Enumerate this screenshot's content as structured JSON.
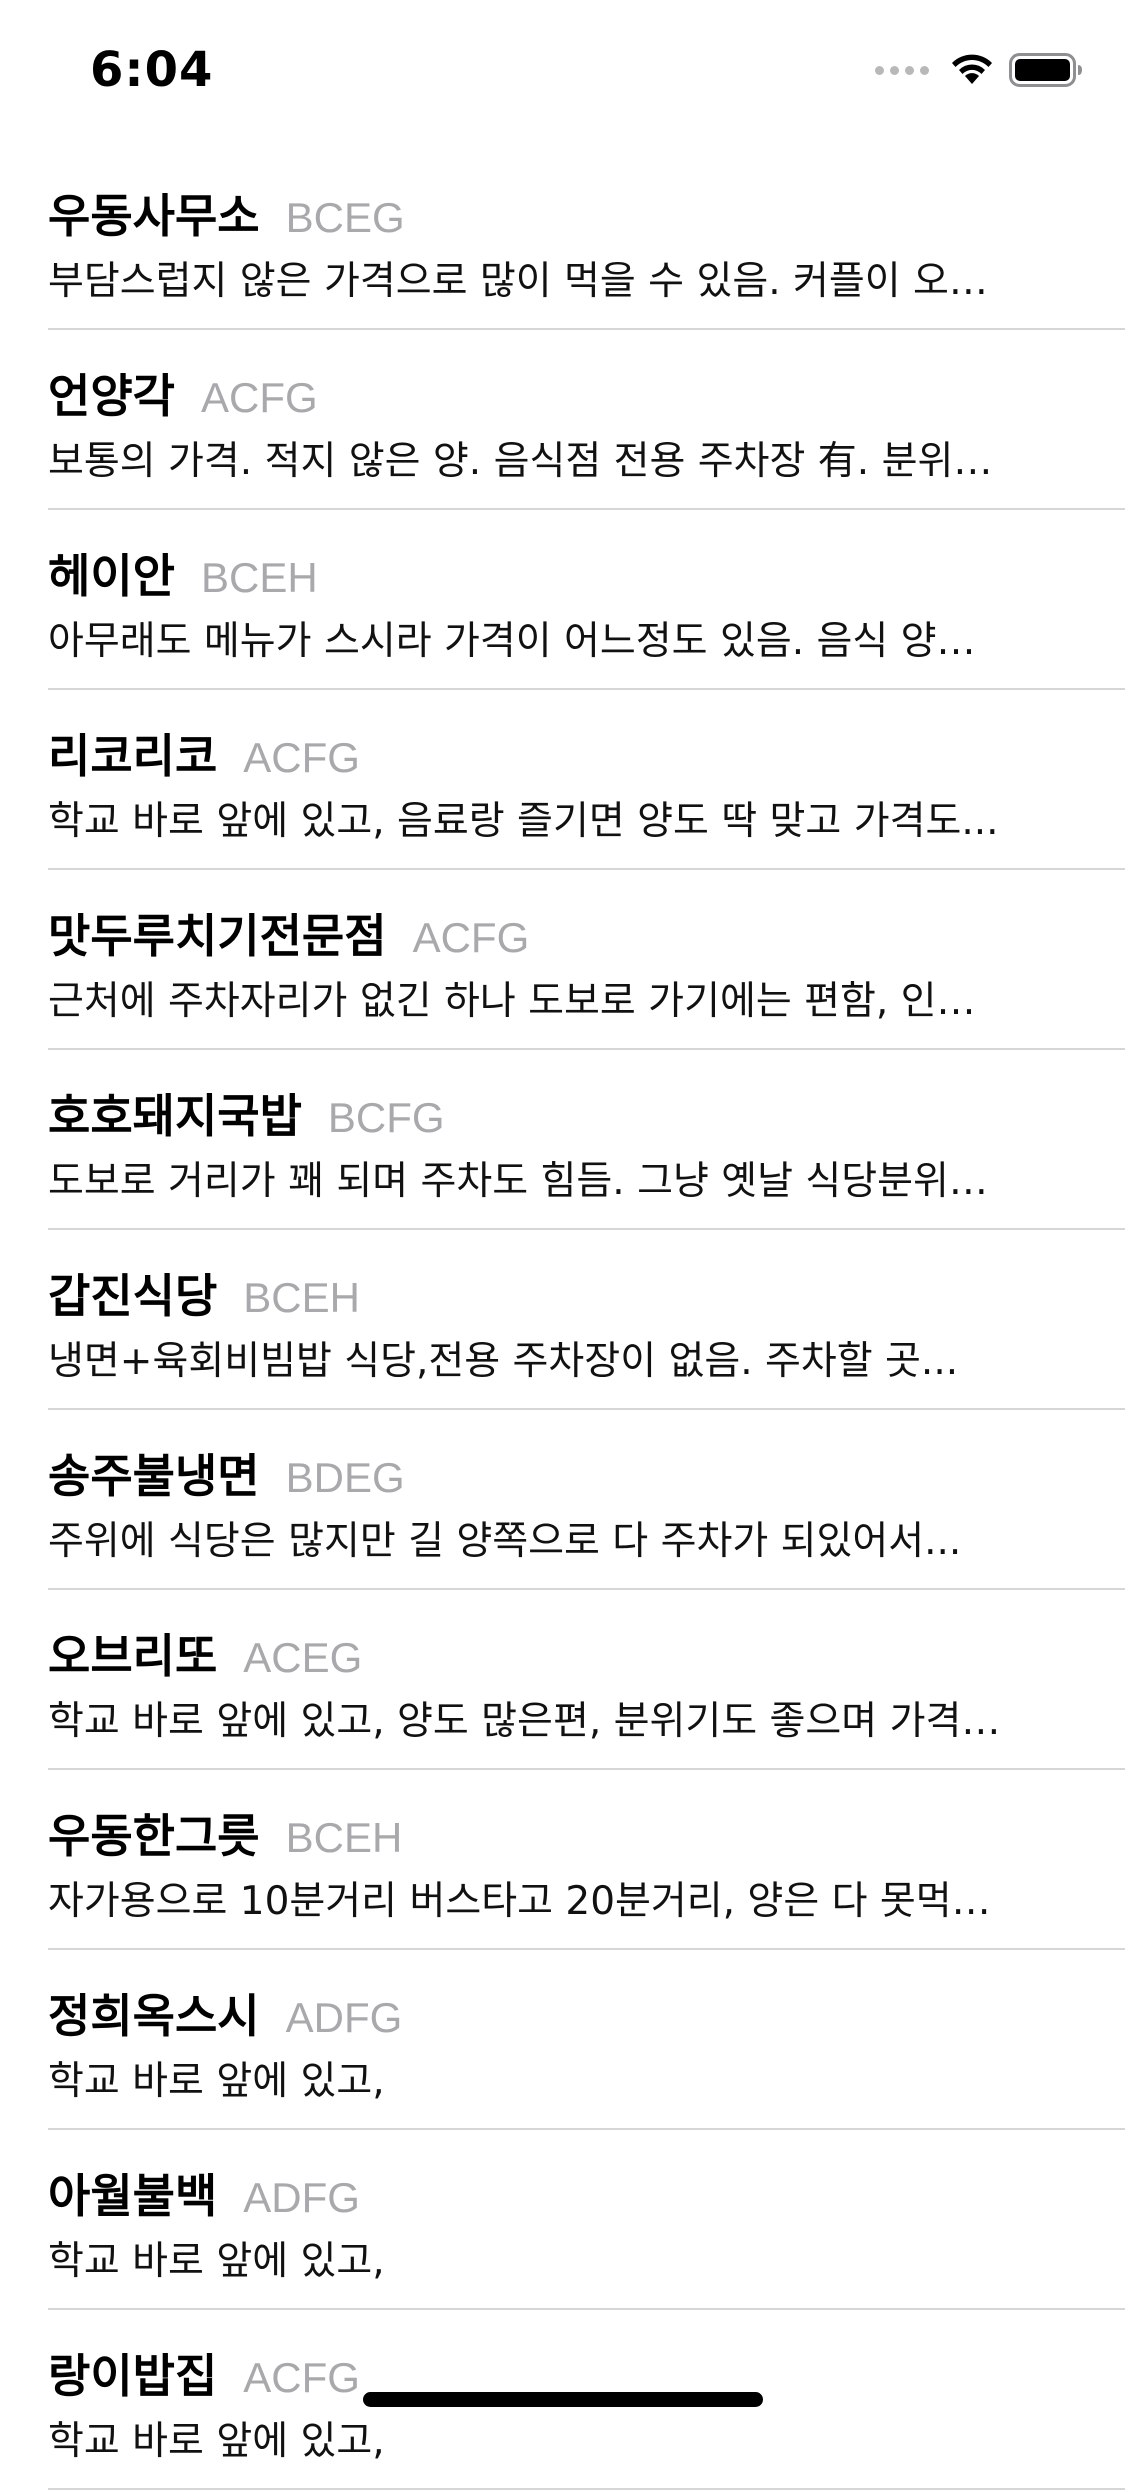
{
  "status_bar": {
    "time": "6:04",
    "icons": [
      "signal-dots-icon",
      "wifi-icon",
      "battery-icon"
    ]
  },
  "restaurants": [
    {
      "name": "우동사무소",
      "code": "BCEG",
      "description": "부담스럽지 않은 가격으로 많이 먹을 수 있음. 커플이 오…"
    },
    {
      "name": "언양각",
      "code": "ACFG",
      "description": "보통의 가격. 적지 않은 양. 음식점 전용 주차장 有. 분위…"
    },
    {
      "name": "헤이안",
      "code": "BCEH",
      "description": "아무래도 메뉴가 스시라 가격이 어느정도 있음. 음식 양…"
    },
    {
      "name": "리코리코",
      "code": "ACFG",
      "description": "학교 바로 앞에 있고, 음료랑 즐기면 양도 딱 맞고 가격도..."
    },
    {
      "name": "맛두루치기전문점",
      "code": "ACFG",
      "description": "근처에 주차자리가 없긴 하나 도보로 가기에는 편함, 인…"
    },
    {
      "name": "호호돼지국밥",
      "code": "BCFG",
      "description": "도보로 거리가 꽤 되며 주차도 힘듬. 그냥 옛날 식당분위…"
    },
    {
      "name": "갑진식당",
      "code": "BCEH",
      "description": "냉면+육회비빔밥 식당,전용 주차장이 없음. 주차할 곳..."
    },
    {
      "name": "송주불냉면",
      "code": "BDEG",
      "description": "주위에 식당은 많지만 길 양쪽으로 다 주차가 되있어서..."
    },
    {
      "name": "오브리또",
      "code": "ACEG",
      "description": "학교 바로 앞에 있고, 양도 많은편, 분위기도 좋으며 가격…"
    },
    {
      "name": "우동한그릇",
      "code": "BCEH",
      "description": "자가용으로 10분거리 버스타고 20분거리, 양은 다 못먹…"
    },
    {
      "name": "정희옥스시",
      "code": "ADFG",
      "description": "학교 바로 앞에 있고,"
    },
    {
      "name": "아월불백",
      "code": "ADFG",
      "description": "학교 바로 앞에 있고,"
    },
    {
      "name": "랑이밥집",
      "code": "ACFG",
      "description": "학교 바로 앞에 있고,"
    }
  ]
}
